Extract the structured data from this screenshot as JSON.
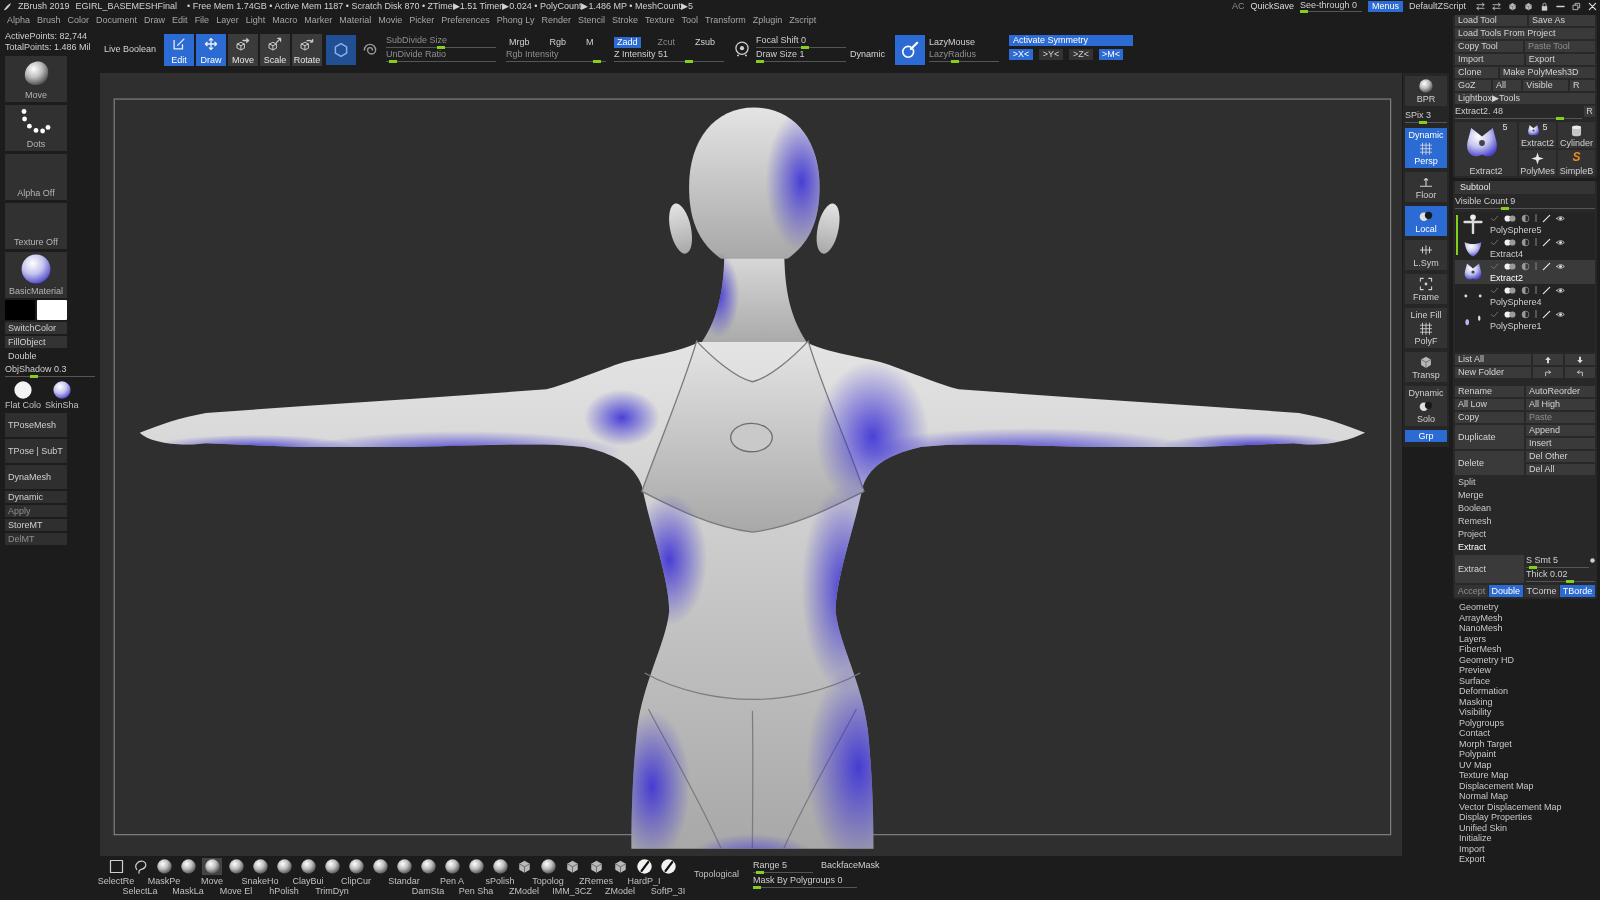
{
  "title_bar": {
    "app": "ZBrush 2019",
    "file": "EGIRL_BASEMESHFinal",
    "stats": "• Free Mem 1.74GB • Active Mem 1187 • Scratch Disk 870 • ZTime▶1.51 Timer▶0.024 • PolyCount▶1.486 MP • MeshCount▶5",
    "ac": "AC",
    "quick_save": "QuickSave",
    "see_through": {
      "label": "See-through 0",
      "level": 0
    },
    "menus": {
      "label": "Menus",
      "on": true
    },
    "script": "DefaultZScript"
  },
  "menu_bar": [
    "Alpha",
    "Brush",
    "Color",
    "Document",
    "Draw",
    "Edit",
    "File",
    "Layer",
    "Light",
    "Macro",
    "Marker",
    "Material",
    "Movie",
    "Picker",
    "Preferences",
    "Phong Ly",
    "Render",
    "Stencil",
    "Stroke",
    "Texture",
    "Tool",
    "Transform",
    "Zplugin",
    "Zscript"
  ],
  "left_panel": {
    "stats": [
      "ActivePoints: 82,744",
      "TotalPoints: 1.486 Mil"
    ],
    "thumbs": [
      {
        "kind": "brush",
        "label": "Move"
      },
      {
        "kind": "stroke",
        "label": "Dots"
      },
      {
        "kind": "alpha",
        "label": "Alpha Off"
      },
      {
        "kind": "texture",
        "label": "Texture Off"
      },
      {
        "kind": "material",
        "label": "BasicMaterial"
      }
    ],
    "swatches": [
      {
        "color": "#000000"
      },
      {
        "color": "#ffffff"
      }
    ],
    "buttons": [
      {
        "label": "SwitchColor",
        "kind": "button"
      },
      {
        "label": "FillObject",
        "kind": "button"
      },
      {
        "label": "Double",
        "kind": "toggle"
      }
    ],
    "obj_shadow": {
      "label": "ObjShadow 0.3",
      "level": 0.3
    },
    "materials": [
      {
        "label": "Flat Colo",
        "kind": "flat"
      },
      {
        "label": "SkinSha",
        "kind": "shaded"
      }
    ],
    "actions": [
      {
        "label": "TPoseMesh",
        "kind": "tall",
        "disabled": false
      },
      {
        "label": "TPose | SubT",
        "kind": "tall",
        "disabled": false
      },
      {
        "label": "DynaMesh",
        "kind": "tall",
        "disabled": false
      },
      {
        "label": "Dynamic",
        "kind": "short",
        "disabled": false
      },
      {
        "label": "Apply",
        "kind": "short",
        "disabled": true
      },
      {
        "label": "StoreMT",
        "kind": "short",
        "disabled": false
      },
      {
        "label": "DelMT",
        "kind": "short",
        "disabled": true
      }
    ]
  },
  "toolbar": {
    "live_boolean": {
      "label": "Live Boolean",
      "on": false
    },
    "modes": [
      {
        "label": "Edit",
        "selected": true
      },
      {
        "label": "Draw",
        "selected": true
      },
      {
        "label": "Move",
        "selected": false
      },
      {
        "label": "Scale",
        "selected": false
      },
      {
        "label": "Rotate",
        "selected": false
      }
    ],
    "subdivide": [
      {
        "label": "SubDivide Size",
        "level": 0.5,
        "disabled": true
      },
      {
        "label": "UnDivide Ratio",
        "level": 0.03,
        "disabled": true
      }
    ],
    "color_modes": [
      {
        "label": "Mrgb",
        "selected": false
      },
      {
        "label": "Rgb",
        "selected": false
      },
      {
        "label": "M",
        "selected": false
      }
    ],
    "rgb_intensity": {
      "label": "Rgb Intensity",
      "level": 0.95,
      "disabled": true
    },
    "z_modes": [
      {
        "label": "Zadd",
        "selected": true,
        "disabled": false
      },
      {
        "label": "Zcut",
        "selected": false,
        "disabled": true
      },
      {
        "label": "Zsub",
        "selected": false,
        "disabled": false
      }
    ],
    "z_intensity": {
      "label": "Z Intensity 51",
      "level": 0.7,
      "disabled": false
    },
    "focal_shift": {
      "label": "Focal Shift 0",
      "level": 0.55
    },
    "draw_size": {
      "label": "Draw Size 1",
      "level": 0
    },
    "dynamic": "Dynamic",
    "lazy_mouse": "LazyMouse",
    "lazy_radius": {
      "label": "LazyRadius",
      "level": 0.35,
      "disabled": true
    },
    "symmetry": {
      "label": "Activate Symmetry",
      "on": true
    },
    "axes": [
      {
        "label": ">X<",
        "selected": true
      },
      {
        "label": ">Y<",
        "selected": false
      },
      {
        "label": ">Z<",
        "selected": false
      },
      {
        "label": ">M<",
        "selected": true
      }
    ]
  },
  "right_shelf": [
    {
      "kind": "icon",
      "label": "BPR",
      "selected": false
    },
    {
      "kind": "slider",
      "label": "SPix 3",
      "level": 0.4
    },
    {
      "kind": "icon",
      "label": "Persp",
      "note": "Dynamic",
      "selected": true
    },
    {
      "kind": "icon",
      "label": "Floor",
      "selected": false
    },
    {
      "kind": "icon",
      "label": "Local",
      "selected": true
    },
    {
      "kind": "icon",
      "label": "L.Sym",
      "selected": false
    },
    {
      "kind": "icon",
      "label": "Frame",
      "selected": false
    },
    {
      "kind": "icon",
      "label": "PolyF",
      "note": "Line Fill",
      "selected": false
    },
    {
      "kind": "icon",
      "label": "Transp",
      "selected": false
    },
    {
      "kind": "icon",
      "label": "Solo",
      "note": "Dynamic",
      "selected": false
    },
    {
      "kind": "text",
      "label": "Grp",
      "selected": true
    }
  ],
  "bottom_shelf": {
    "brushes": [
      {
        "kind": "select",
        "label": "SelectRe",
        "selected": false
      },
      {
        "kind": "lasso",
        "label": "SelectLa",
        "selected": false
      },
      {
        "kind": "sculpt",
        "label": "MaskPe",
        "selected": false
      },
      {
        "kind": "sculpt",
        "label": "MaskLa",
        "selected": false
      },
      {
        "kind": "sculpt",
        "label": "Move",
        "selected": true
      },
      {
        "kind": "sculpt",
        "label": "Move El",
        "selected": false
      },
      {
        "kind": "sculpt",
        "label": "SnakeHo",
        "selected": false
      },
      {
        "kind": "sculpt",
        "label": "hPolish",
        "selected": false
      },
      {
        "kind": "sculpt",
        "label": "ClayBui",
        "selected": false
      },
      {
        "kind": "sculpt",
        "label": "TrimDyn",
        "selected": false
      },
      {
        "kind": "sculpt",
        "label": "ClipCur",
        "selected": false
      },
      {
        "kind": "sculpt",
        "selected": false
      },
      {
        "kind": "sculpt",
        "label": "Standar",
        "selected": false
      },
      {
        "kind": "sculpt",
        "label": "DamSta",
        "selected": false
      },
      {
        "kind": "sculpt",
        "label": "Pen A",
        "selected": false
      },
      {
        "kind": "sculpt",
        "label": "Pen Sha",
        "selected": false
      },
      {
        "kind": "sculpt",
        "label": "sPolish",
        "selected": false
      },
      {
        "kind": "mesh",
        "label": "ZModel",
        "selected": false
      },
      {
        "kind": "sculpt",
        "label": "Topolog",
        "selected": false
      },
      {
        "kind": "mesh",
        "label": "IMM_3CZ",
        "selected": false
      },
      {
        "kind": "mesh",
        "label": "ZRemes",
        "selected": false
      },
      {
        "kind": "mesh",
        "label": "ZModel",
        "selected": false
      },
      {
        "kind": "pen",
        "label": "HardP_I",
        "selected": false
      },
      {
        "kind": "pen",
        "label": "SoftP_3I",
        "selected": false
      }
    ],
    "topological": {
      "label": "Topological",
      "on": false
    },
    "range": {
      "label": "Range 5",
      "level": 0.05
    },
    "backface_mask": {
      "label": "BackfaceMask",
      "on": false
    },
    "mask_by_polygroups": {
      "label": "Mask By Polygroups 0",
      "level": 0
    }
  },
  "tool_palette": {
    "rows": [
      [
        {
          "label": "Load Tool",
          "disabled": false
        },
        {
          "label": "Save As",
          "disabled": false
        }
      ],
      [
        {
          "label": "Load Tools From Project",
          "disabled": false
        }
      ],
      [
        {
          "label": "Copy Tool",
          "disabled": false
        },
        {
          "label": "Paste Tool",
          "disabled": true
        }
      ],
      [
        {
          "label": "Import",
          "disabled": false
        },
        {
          "label": "Export",
          "disabled": false
        }
      ],
      [
        {
          "label": "Clone",
          "disabled": false
        },
        {
          "label": "Make PolyMesh3D",
          "disabled": false
        }
      ],
      [
        {
          "label": "GoZ",
          "disabled": false
        },
        {
          "label": "All",
          "disabled": false
        },
        {
          "label": "Visible",
          "disabled": false
        },
        {
          "label": "R",
          "disabled": false
        }
      ],
      [
        {
          "label": "Lightbox▶Tools",
          "disabled": false
        }
      ]
    ],
    "current": {
      "label": "Extract2. 48",
      "level": 0.85,
      "reset": "R"
    },
    "tools": [
      {
        "label": "Extract2",
        "count": "5",
        "kind": "large"
      },
      {
        "label": "Extract2",
        "count": "5",
        "kind": "small"
      },
      {
        "label": "Cylinder",
        "kind": "small"
      },
      {
        "label": "PolyMes",
        "kind": "small"
      },
      {
        "label": "SimpleB",
        "kind": "small",
        "glyph": "S"
      }
    ]
  },
  "subtool": {
    "title": "Subtool",
    "visible_count": {
      "label": "Visible Count 9",
      "level": 0.35
    },
    "items": [
      {
        "name": "PolySphere5",
        "selected": false
      },
      {
        "name": "Extract4",
        "selected": false
      },
      {
        "name": "Extract2",
        "selected": true
      },
      {
        "name": "PolySphere4",
        "selected": false
      },
      {
        "name": "PolySphere1",
        "selected": false
      }
    ],
    "list_controls": [
      {
        "label": "List All"
      },
      {
        "label": "New Folder"
      }
    ],
    "actions": [
      [
        {
          "label": "Rename",
          "disabled": false
        },
        {
          "label": "AutoReorder",
          "disabled": false
        }
      ],
      [
        {
          "label": "All Low",
          "disabled": false
        },
        {
          "label": "All High",
          "disabled": false
        }
      ],
      [
        {
          "label": "Copy",
          "disabled": false
        },
        {
          "label": "Paste",
          "disabled": true
        }
      ],
      [
        {
          "label": "Duplicate",
          "disabled": false
        },
        {
          "label": "Append",
          "disabled": false
        },
        {
          "label": "Insert",
          "disabled": false
        }
      ],
      [
        {
          "label": "Delete",
          "disabled": false
        },
        {
          "label": "Del Other",
          "disabled": false
        },
        {
          "label": "Del All",
          "disabled": false
        }
      ]
    ],
    "sections": [
      {
        "label": "Split",
        "expanded": false
      },
      {
        "label": "Merge",
        "expanded": false
      },
      {
        "label": "Boolean",
        "expanded": false
      },
      {
        "label": "Remesh",
        "expanded": false
      },
      {
        "label": "Project",
        "expanded": false
      },
      {
        "label": "Extract",
        "expanded": true
      }
    ],
    "extract": {
      "button": "Extract",
      "sliders": [
        {
          "label": "S Smt 5",
          "level": 0.05
        },
        {
          "label": "Thick 0.02",
          "level": 0.65
        }
      ],
      "options": [
        {
          "label": "Accept",
          "selected": false,
          "disabled": true
        },
        {
          "label": "Double",
          "selected": true,
          "disabled": false
        },
        {
          "label": "TCorne",
          "selected": false,
          "disabled": false
        },
        {
          "label": "TBorde",
          "selected": true,
          "disabled": false
        }
      ]
    }
  },
  "sub_palettes": [
    "Geometry",
    "ArrayMesh",
    "NanoMesh",
    "Layers",
    "FiberMesh",
    "Geometry HD",
    "Preview",
    "Surface",
    "Deformation",
    "Masking",
    "Visibility",
    "Polygroups",
    "Contact",
    "Morph Target",
    "Polypaint",
    "UV Map",
    "Texture Map",
    "Displacement Map",
    "Normal Map",
    "Vector Displacement Map",
    "Display Properties",
    "Unified Skin",
    "Initialize",
    "Import",
    "Export"
  ]
}
